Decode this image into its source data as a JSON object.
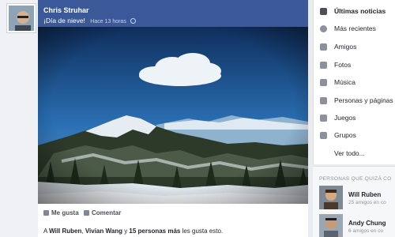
{
  "post": {
    "author": "Chris Struhar",
    "status": "¡Día de nieve!",
    "time": "Hace 13 horas",
    "like_label": "Me gusta",
    "comment_label": "Comentar",
    "likes": {
      "prefix": "A ",
      "name1": "Will Ruben",
      "sep": ", ",
      "name2": "Vivian Wang",
      "and": " y ",
      "more": "15 personas más",
      "suffix": " les gusta esto."
    }
  },
  "menu": {
    "items": [
      {
        "label": "Últimas noticias",
        "icon": "news-icon"
      },
      {
        "label": "Más recientes",
        "icon": "clock-icon"
      },
      {
        "label": "Amigos",
        "icon": "friends-icon"
      },
      {
        "label": "Fotos",
        "icon": "photos-icon"
      },
      {
        "label": "Música",
        "icon": "music-icon"
      },
      {
        "label": "Personas y páginas",
        "icon": "pages-icon"
      },
      {
        "label": "Juegos",
        "icon": "games-icon"
      },
      {
        "label": "Grupos",
        "icon": "groups-icon"
      },
      {
        "label": "Ver todo...",
        "icon": ""
      }
    ]
  },
  "people": {
    "title": "PERSONAS QUE QUIZÁ CO",
    "list": [
      {
        "name": "Will Ruben",
        "mutual": "25 amigos en co"
      },
      {
        "name": "Andy Chung",
        "mutual": "6 amigos en co"
      }
    ]
  },
  "colors": {
    "header": "#3b5998",
    "sky": "#2a6fb3"
  }
}
